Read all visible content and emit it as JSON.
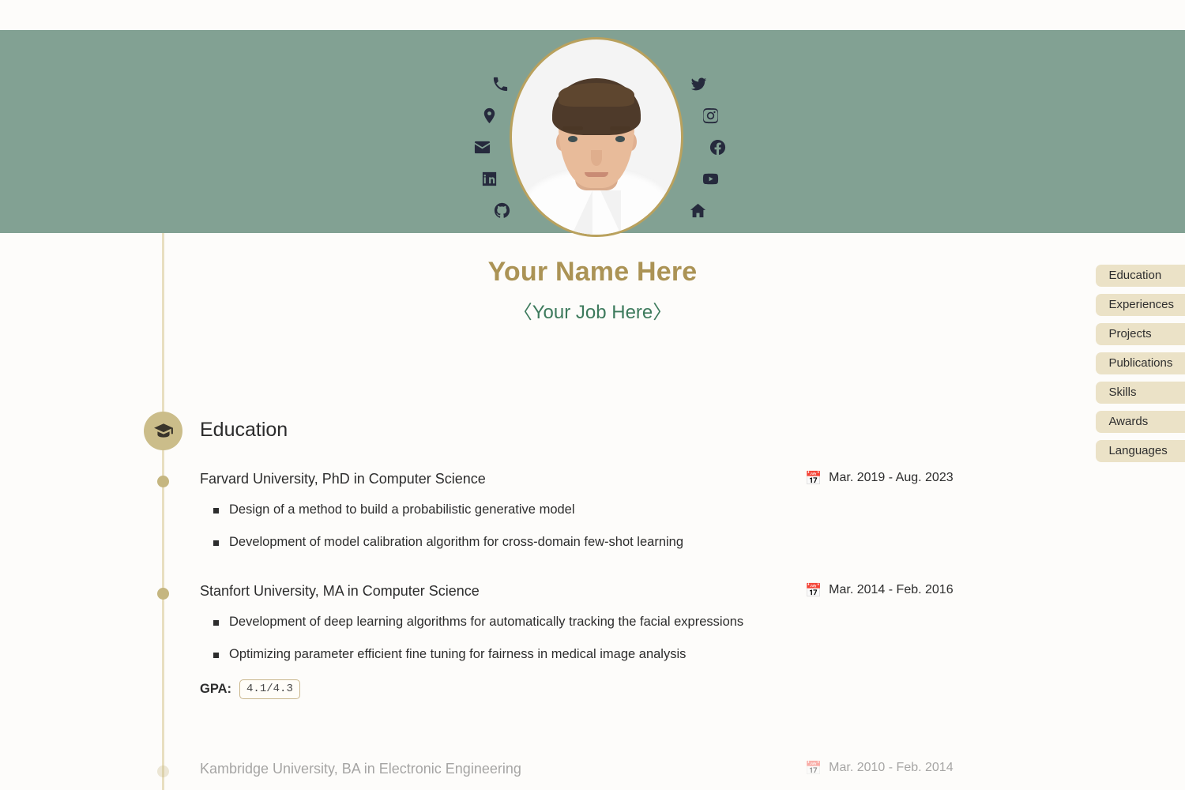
{
  "theme": {
    "banner_color": "#82a193",
    "page_background": "#fdfcfa",
    "gold_accent": "#ab9355",
    "timeline_color": "#e8dfc0",
    "pill_color": "#ebe2c7",
    "job_color": "#3d7a5c"
  },
  "header": {
    "avatar_alt": "profile-photo",
    "social_left": [
      {
        "icon": "phone-icon",
        "label": "Phone"
      },
      {
        "icon": "location-pin-icon",
        "label": "Location"
      },
      {
        "icon": "email-icon",
        "label": "Email"
      },
      {
        "icon": "linkedin-icon",
        "label": "LinkedIn"
      },
      {
        "icon": "github-icon",
        "label": "GitHub"
      }
    ],
    "social_right": [
      {
        "icon": "twitter-icon",
        "label": "Twitter"
      },
      {
        "icon": "instagram-icon",
        "label": "Instagram"
      },
      {
        "icon": "facebook-icon",
        "label": "Facebook"
      },
      {
        "icon": "youtube-icon",
        "label": "YouTube"
      },
      {
        "icon": "home-icon",
        "label": "Homepage"
      }
    ]
  },
  "profile": {
    "name": "Your Name Here",
    "job": "〈Your Job Here〉"
  },
  "nav": {
    "items": [
      {
        "label": "Education"
      },
      {
        "label": "Experiences"
      },
      {
        "label": "Projects"
      },
      {
        "label": "Publications"
      },
      {
        "label": "Skills"
      },
      {
        "label": "Awards"
      },
      {
        "label": "Languages"
      }
    ]
  },
  "section": {
    "icon": "graduation-cap-icon",
    "title": "Education"
  },
  "education": {
    "entries": [
      {
        "title": "Farvard University, PhD in Computer Science",
        "date": "Mar. 2019 - Aug. 2023",
        "date_icon": "calendar-icon",
        "bullets": [
          "Design of a method to build a probabilistic generative model",
          "Development of model calibration algorithm for cross-domain few-shot learning"
        ]
      },
      {
        "title": "Stanfort University, MA in Computer Science",
        "date": "Mar. 2014 - Feb. 2016",
        "date_icon": "calendar-icon",
        "bullets": [
          "Development of deep learning algorithms for automatically tracking the facial expressions",
          "Optimizing parameter efficient fine tuning for fairness in medical image analysis"
        ],
        "gpa_label": "GPA:",
        "gpa_value": "4.1/4.3"
      },
      {
        "title": "Kambridge University, BA in Electronic Engineering",
        "date": "Mar. 2010 - Feb. 2014",
        "date_icon": "calendar-icon"
      }
    ]
  },
  "icons": {
    "calendar_glyph": "📅"
  }
}
